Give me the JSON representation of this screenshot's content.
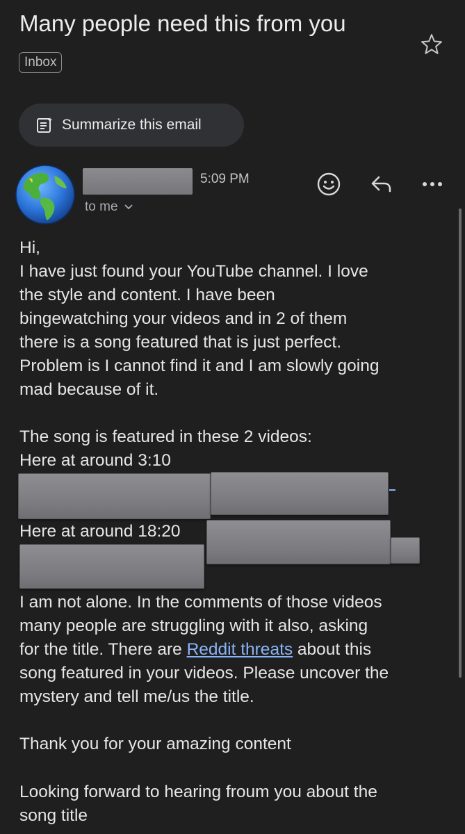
{
  "email": {
    "subject": "Many people need this from you",
    "label": "Inbox",
    "summarize_label": "Summarize this email",
    "time": "5:09 PM",
    "recipient": "to me",
    "body": {
      "greeting": "Hi,",
      "paragraph1": "I have just found your YouTube channel. I love\nthe style and content. I have been\nbingewatching your videos and in 2 of them\nthere is a song featured that is just perfect.\nProblem is I cannot find it and I am slowly going\nmad because of it.",
      "videos_intro": "The song is featured in these 2 videos:",
      "video1_text": "Here at around 3:10",
      "video2_text": "Here at around 18:20",
      "paragraph3_a": "I am not alone. In the comments of those videos\nmany people are struggling with it also, asking\nfor the title. There are ",
      "reddit_link": "Reddit threats",
      "paragraph3_b": " about this\nsong featured in your videos. Please uncover the\nmystery and tell me/us the title.",
      "thanks": "Thank you for your amazing content",
      "closing": "Looking forward to hearing froum you about the\nsong title"
    }
  },
  "icons": {
    "star": "star-icon",
    "summarize": "summarize-icon",
    "avatar": "earth-globe-icon",
    "expand": "chevron-down-icon",
    "react": "emoji-icon",
    "reply": "reply-icon",
    "more": "more-horizontal-icon"
  },
  "colors": {
    "background": "#1f1f1f",
    "chip": "#303134",
    "link": "#8ab4f8",
    "redaction": "#838388"
  }
}
